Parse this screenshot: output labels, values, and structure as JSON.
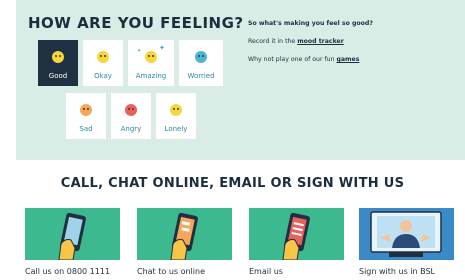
{
  "mood": {
    "title": "HOW ARE YOU FEELING?",
    "options": [
      {
        "label": "Good",
        "icon": "happy-face-icon",
        "color": "#f5d63d"
      },
      {
        "label": "Okay",
        "icon": "neutral-face-icon",
        "color": "#f5d63d"
      },
      {
        "label": "Amazing",
        "icon": "amazing-face-icon",
        "color": "#f5d63d"
      },
      {
        "label": "Worried",
        "icon": "worried-face-icon",
        "color": "#49b6d6"
      },
      {
        "label": "Sad",
        "icon": "sad-face-icon",
        "color": "#f5a65b"
      },
      {
        "label": "Angry",
        "icon": "angry-face-icon",
        "color": "#e8615c"
      },
      {
        "label": "Lonely",
        "icon": "lonely-face-icon",
        "color": "#f5d63d"
      }
    ],
    "selected": "Good"
  },
  "prompts": {
    "heading": "So what's making you feel so good?",
    "tracker_prefix": "Record it in the ",
    "tracker_link": "mood tracker",
    "games_prefix": "Why not play one of our fun ",
    "games_link": "games"
  },
  "contact": {
    "heading": "CALL, CHAT ONLINE, EMAIL OR SIGN WITH US",
    "options": [
      {
        "label": "Call us on 0800 1111",
        "icon": "phone-call-icon"
      },
      {
        "label": "Chat to us online",
        "icon": "chat-phone-icon"
      },
      {
        "label": "Email us",
        "icon": "email-phone-icon"
      },
      {
        "label": "Sign with us in BSL",
        "icon": "bsl-sign-icon"
      }
    ]
  },
  "colors": {
    "panel": "#d9ede6",
    "navy": "#1c2e3e",
    "green": "#3cb98f",
    "blue": "#3a8ac8",
    "label_teal": "#2a8aa0"
  }
}
